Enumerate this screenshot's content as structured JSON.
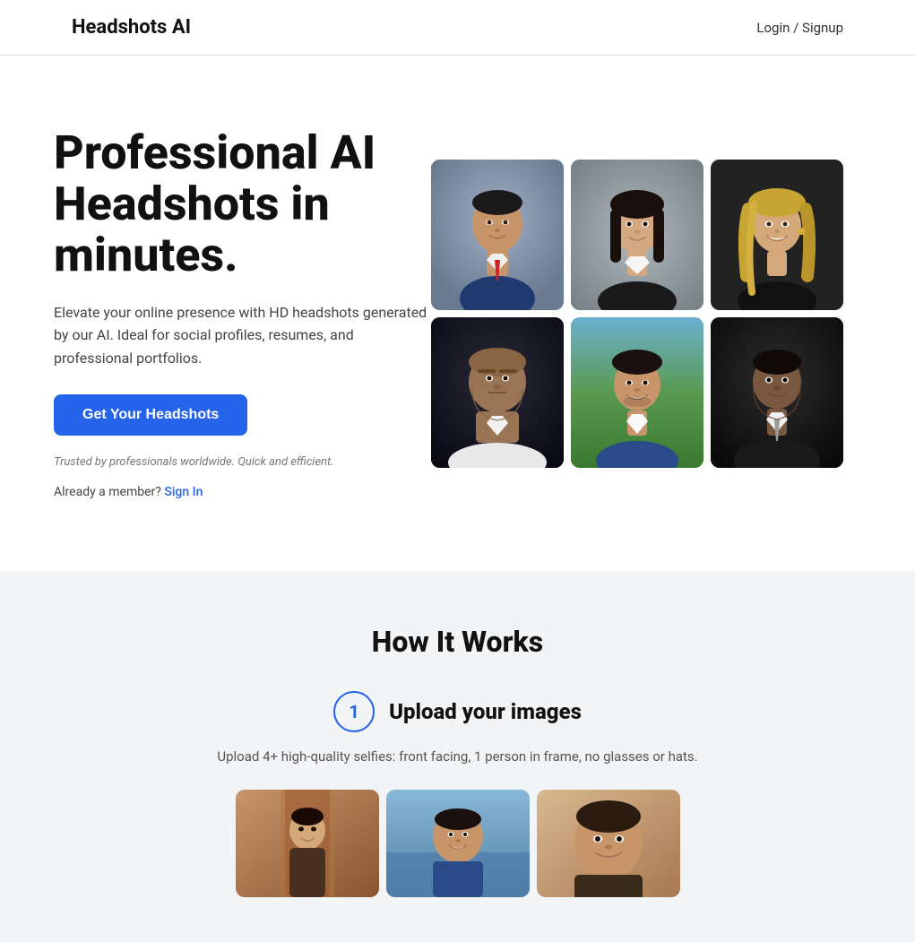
{
  "navbar": {
    "brand": "Headshots AI",
    "login_label": "Login / Signup"
  },
  "hero": {
    "title": "Professional AI Headshots in minutes.",
    "subtitle": "Elevate your online presence with HD headshots generated by our AI. Ideal for social profiles, resumes, and professional portfolios.",
    "cta_button": "Get Your Headshots",
    "trusted_text": "Trusted by professionals worldwide. Quick and efficient.",
    "signin_prompt": "Already a member?",
    "signin_link": "Sign In"
  },
  "photos": [
    {
      "id": 1,
      "desc": "Man in blue suit, red tie",
      "bg": "#8b9bb2"
    },
    {
      "id": 2,
      "desc": "Woman with dark hair",
      "bg": "#9ba4a9"
    },
    {
      "id": 3,
      "desc": "Blonde woman smiling",
      "bg": "#2c2c2c"
    },
    {
      "id": 4,
      "desc": "Bald man serious",
      "bg": "#1e1e2e"
    },
    {
      "id": 5,
      "desc": "Young man outdoors",
      "bg": "#4f7c5a"
    },
    {
      "id": 6,
      "desc": "Black man in dark suit",
      "bg": "#1c1c1c"
    }
  ],
  "how_it_works": {
    "section_title": "How It Works",
    "steps": [
      {
        "number": "1",
        "label": "Upload your images",
        "description": "Upload 4+ high-quality selfies: front facing, 1 person in frame, no glasses or hats."
      }
    ]
  },
  "upload_previews": [
    {
      "id": 1,
      "desc": "Preview image 1"
    },
    {
      "id": 2,
      "desc": "Preview image 2"
    },
    {
      "id": 3,
      "desc": "Preview image 3"
    }
  ]
}
